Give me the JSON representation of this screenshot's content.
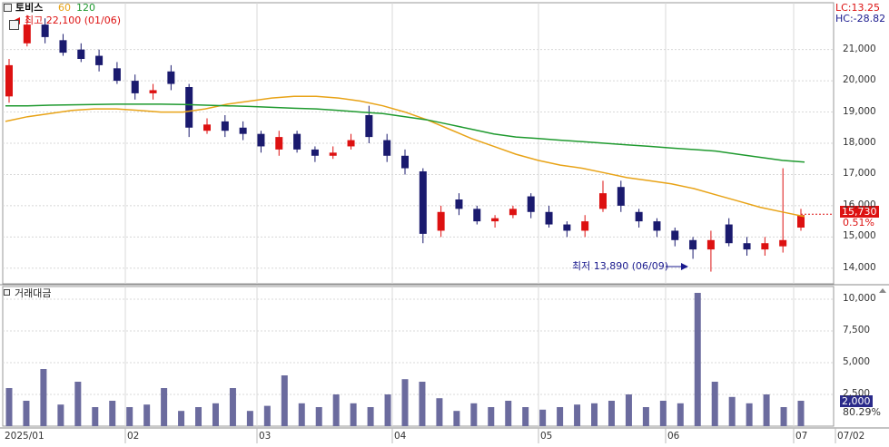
{
  "header": {
    "ticker": "토비스",
    "ma60_label": "60",
    "ma120_label": "120",
    "lc_label": "LC:13.25",
    "hc_label": "HC:-28.82",
    "high_label": "최고 22,100 (01/06)",
    "low_label": "최저 13,890 (06/09)",
    "volume_title": "거래대금"
  },
  "badges": {
    "price": "15,730",
    "price_change": "0.51%",
    "volume": "2,000",
    "volume_pct": "80.29%"
  },
  "colors": {
    "up": "#dd1111",
    "down": "#1a1a6e",
    "ma60": "#e8a317",
    "ma120": "#1f9a2f",
    "volume": "#6b6b9e",
    "grid": "#d8d8d8"
  },
  "chart_data": [
    {
      "type": "candlestick",
      "title": "토비스",
      "ylim": [
        13500,
        22500
      ],
      "y_ticks": [
        "21,000",
        "20,000",
        "19,000",
        "18,000",
        "17,000",
        "16,000",
        "15,000",
        "14,000"
      ],
      "x_ticks": [
        "2025/01",
        "02",
        "03",
        "04",
        "05",
        "06",
        "07",
        "07/02"
      ],
      "series": [
        {
          "name": "60",
          "values": [
            18700,
            18850,
            18950,
            19050,
            19100,
            19100,
            19050,
            19000,
            19000,
            19100,
            19250,
            19350,
            19450,
            19500,
            19500,
            19450,
            19350,
            19200,
            19000,
            18750,
            18450,
            18150,
            17900,
            17650,
            17450,
            17300,
            17200,
            17050,
            16900,
            16800,
            16700,
            16550,
            16350,
            16150,
            15950,
            15800,
            15650
          ]
        },
        {
          "name": "120",
          "values": [
            19200,
            19200,
            19220,
            19230,
            19240,
            19250,
            19250,
            19250,
            19240,
            19220,
            19200,
            19180,
            19150,
            19120,
            19100,
            19050,
            19000,
            18950,
            18850,
            18750,
            18600,
            18450,
            18300,
            18200,
            18150,
            18100,
            18050,
            18000,
            17950,
            17900,
            17850,
            17800,
            17750,
            17650,
            17550,
            17450,
            17400
          ]
        }
      ],
      "candles": [
        [
          19500,
          20500,
          19300,
          20700
        ],
        [
          21200,
          21800,
          21100,
          22100
        ],
        [
          21800,
          21400,
          21200,
          22000
        ],
        [
          21300,
          20900,
          20800,
          21500
        ],
        [
          21000,
          20700,
          20600,
          21200
        ],
        [
          20800,
          20500,
          20300,
          21000
        ],
        [
          20400,
          20000,
          19900,
          20600
        ],
        [
          20000,
          19600,
          19400,
          20200
        ],
        [
          19600,
          19700,
          19400,
          19900
        ],
        [
          20300,
          19900,
          19700,
          20500
        ],
        [
          19800,
          18500,
          18200,
          19900
        ],
        [
          18400,
          18600,
          18300,
          18800
        ],
        [
          18700,
          18400,
          18200,
          18900
        ],
        [
          18500,
          18300,
          18100,
          18700
        ],
        [
          18300,
          17900,
          17700,
          18400
        ],
        [
          17800,
          18200,
          17600,
          18400
        ],
        [
          18300,
          17800,
          17700,
          18400
        ],
        [
          17800,
          17600,
          17400,
          17900
        ],
        [
          17600,
          17700,
          17500,
          17900
        ],
        [
          17900,
          18100,
          17800,
          18300
        ],
        [
          18900,
          18200,
          18000,
          19200
        ],
        [
          18100,
          17600,
          17400,
          18300
        ],
        [
          17600,
          17200,
          17000,
          17800
        ],
        [
          17100,
          15100,
          14800,
          17200
        ],
        [
          15200,
          15800,
          15000,
          16000
        ],
        [
          16200,
          15900,
          15700,
          16400
        ],
        [
          15900,
          15500,
          15400,
          16000
        ],
        [
          15500,
          15600,
          15300,
          15700
        ],
        [
          15700,
          15900,
          15600,
          16000
        ],
        [
          16300,
          15800,
          15600,
          16400
        ],
        [
          15800,
          15400,
          15300,
          16000
        ],
        [
          15400,
          15200,
          15000,
          15500
        ],
        [
          15200,
          15500,
          15000,
          15700
        ],
        [
          15900,
          16400,
          15800,
          16800
        ],
        [
          16600,
          16000,
          15800,
          16800
        ],
        [
          15800,
          15500,
          15300,
          15900
        ],
        [
          15500,
          15200,
          15000,
          15600
        ],
        [
          15200,
          14900,
          14700,
          15300
        ],
        [
          14900,
          14600,
          14300,
          15000
        ],
        [
          14600,
          14900,
          13890,
          15200
        ],
        [
          15400,
          14800,
          14700,
          15600
        ],
        [
          14800,
          14600,
          14400,
          15000
        ],
        [
          14600,
          14800,
          14400,
          15000
        ],
        [
          14700,
          14900,
          14500,
          17200
        ],
        [
          15300,
          15700,
          15200,
          15900
        ]
      ],
      "annotations": [
        "최고 22,100 (01/06)",
        "최저 13,890 (06/09)"
      ]
    },
    {
      "type": "bar",
      "title": "거래대금",
      "ylim": [
        0,
        11000
      ],
      "y_ticks": [
        "10,000",
        "7,500",
        "5,000",
        "2,500"
      ],
      "values": [
        3000,
        2000,
        4500,
        1700,
        3500,
        1500,
        2000,
        1500,
        1700,
        3000,
        1200,
        1500,
        1800,
        3000,
        1200,
        1600,
        4000,
        1800,
        1500,
        2500,
        1800,
        1500,
        2500,
        3700,
        3500,
        2200,
        1200,
        1800,
        1500,
        2000,
        1500,
        1300,
        1500,
        1700,
        1800,
        2000,
        2500,
        1500,
        2000,
        1800,
        10500,
        3500,
        2300,
        1800,
        2500,
        1500,
        2000
      ]
    }
  ]
}
